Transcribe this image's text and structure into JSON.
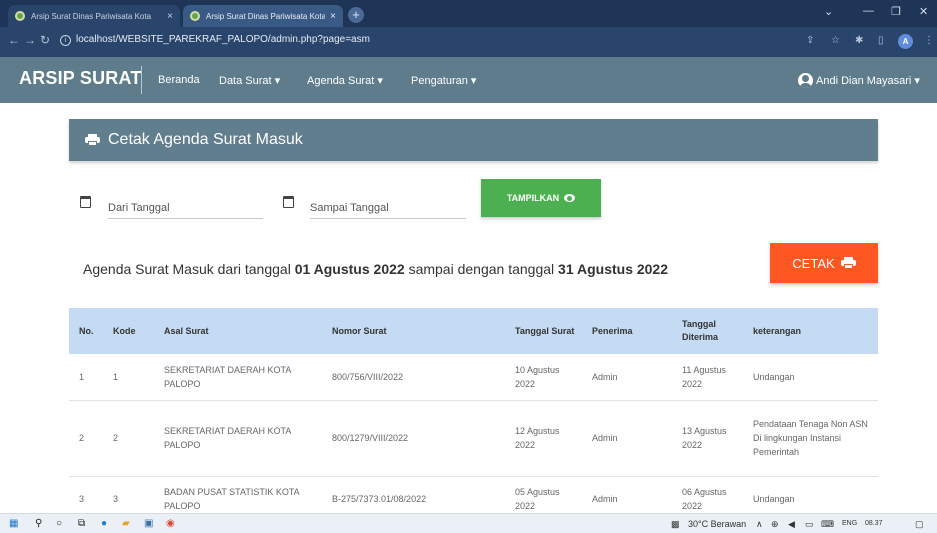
{
  "browser": {
    "tabs": [
      {
        "title": "Arsip Surat Dinas Pariwisata Kota",
        "close": "×"
      },
      {
        "title": "Arsip Surat Dinas Pariwisata Kota",
        "close": "×"
      }
    ],
    "new_tab": "+",
    "url": "localhost/WEBSITE_PAREKRAF_PALOPO/admin.php?page=asm",
    "profile_initial": "A"
  },
  "navbar": {
    "brand": "ARSIP SURAT",
    "items": [
      {
        "label": "Beranda"
      },
      {
        "label": "Data Surat ▾"
      },
      {
        "label": "Agenda Surat ▾"
      },
      {
        "label": "Pengaturan ▾"
      }
    ],
    "user": "Andi Dian Mayasari ▾"
  },
  "panel": {
    "title": "Cetak Agenda Surat Masuk"
  },
  "filter": {
    "from_placeholder": "Dari Tanggal",
    "to_placeholder": "Sampai Tanggal",
    "show_button": "TAMPILKAN"
  },
  "summary": {
    "prefix": "Agenda Surat Masuk dari tanggal ",
    "start_date": "01 Agustus 2022",
    "middle": " sampai dengan tanggal ",
    "end_date": "31 Agustus 2022"
  },
  "print_button": "CETAK",
  "table": {
    "headers": [
      "No.",
      "Kode",
      "Asal Surat",
      "Nomor Surat",
      "Tanggal Surat",
      "Penerima",
      "Tanggal Diterima",
      "keterangan"
    ],
    "rows": [
      {
        "no": "1",
        "kode": "1",
        "asal": "SEKRETARIAT DAERAH KOTA PALOPO",
        "nomor": "800/756/VIII/2022",
        "tgl_surat": "10 Agustus 2022",
        "penerima": "Admin",
        "tgl_diterima": "11 Agustus 2022",
        "keterangan": "Undangan"
      },
      {
        "no": "2",
        "kode": "2",
        "asal": "SEKRETARIAT DAERAH KOTA PALOPO",
        "nomor": "800/1279/VIII/2022",
        "tgl_surat": "12 Agustus 2022",
        "penerima": "Admin",
        "tgl_diterima": "13 Agustus 2022",
        "keterangan": "Pendataan Tenaga Non ASN Di lingkungan Instansi Pemerintah"
      },
      {
        "no": "3",
        "kode": "3",
        "asal": "BADAN PUSAT STATISTIK KOTA PALOPO",
        "nomor": "B-275/7373.01/08/2022",
        "tgl_surat": "05 Agustus 2022",
        "penerima": "Admin",
        "tgl_diterima": "06 Agustus 2022",
        "keterangan": "Undangan"
      }
    ]
  },
  "taskbar": {
    "weather": "30°C Berawan",
    "lang": "ENG",
    "time": "08.37"
  }
}
